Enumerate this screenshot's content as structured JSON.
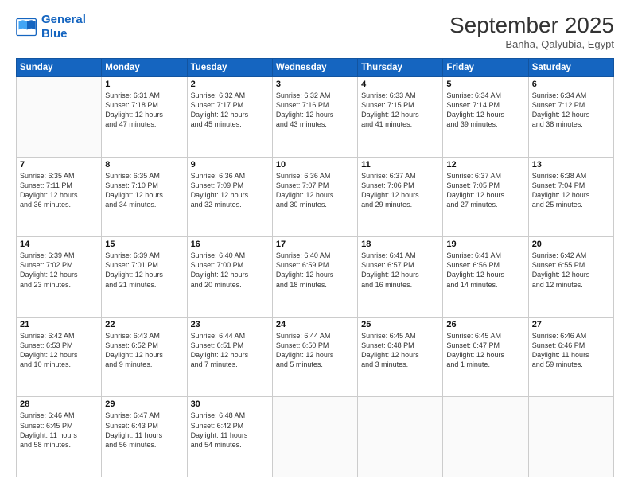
{
  "header": {
    "logo_line1": "General",
    "logo_line2": "Blue",
    "month": "September 2025",
    "location": "Banha, Qalyubia, Egypt"
  },
  "days_of_week": [
    "Sunday",
    "Monday",
    "Tuesday",
    "Wednesday",
    "Thursday",
    "Friday",
    "Saturday"
  ],
  "weeks": [
    [
      {
        "day": "",
        "text": ""
      },
      {
        "day": "1",
        "text": "Sunrise: 6:31 AM\nSunset: 7:18 PM\nDaylight: 12 hours\nand 47 minutes."
      },
      {
        "day": "2",
        "text": "Sunrise: 6:32 AM\nSunset: 7:17 PM\nDaylight: 12 hours\nand 45 minutes."
      },
      {
        "day": "3",
        "text": "Sunrise: 6:32 AM\nSunset: 7:16 PM\nDaylight: 12 hours\nand 43 minutes."
      },
      {
        "day": "4",
        "text": "Sunrise: 6:33 AM\nSunset: 7:15 PM\nDaylight: 12 hours\nand 41 minutes."
      },
      {
        "day": "5",
        "text": "Sunrise: 6:34 AM\nSunset: 7:14 PM\nDaylight: 12 hours\nand 39 minutes."
      },
      {
        "day": "6",
        "text": "Sunrise: 6:34 AM\nSunset: 7:12 PM\nDaylight: 12 hours\nand 38 minutes."
      }
    ],
    [
      {
        "day": "7",
        "text": "Sunrise: 6:35 AM\nSunset: 7:11 PM\nDaylight: 12 hours\nand 36 minutes."
      },
      {
        "day": "8",
        "text": "Sunrise: 6:35 AM\nSunset: 7:10 PM\nDaylight: 12 hours\nand 34 minutes."
      },
      {
        "day": "9",
        "text": "Sunrise: 6:36 AM\nSunset: 7:09 PM\nDaylight: 12 hours\nand 32 minutes."
      },
      {
        "day": "10",
        "text": "Sunrise: 6:36 AM\nSunset: 7:07 PM\nDaylight: 12 hours\nand 30 minutes."
      },
      {
        "day": "11",
        "text": "Sunrise: 6:37 AM\nSunset: 7:06 PM\nDaylight: 12 hours\nand 29 minutes."
      },
      {
        "day": "12",
        "text": "Sunrise: 6:37 AM\nSunset: 7:05 PM\nDaylight: 12 hours\nand 27 minutes."
      },
      {
        "day": "13",
        "text": "Sunrise: 6:38 AM\nSunset: 7:04 PM\nDaylight: 12 hours\nand 25 minutes."
      }
    ],
    [
      {
        "day": "14",
        "text": "Sunrise: 6:39 AM\nSunset: 7:02 PM\nDaylight: 12 hours\nand 23 minutes."
      },
      {
        "day": "15",
        "text": "Sunrise: 6:39 AM\nSunset: 7:01 PM\nDaylight: 12 hours\nand 21 minutes."
      },
      {
        "day": "16",
        "text": "Sunrise: 6:40 AM\nSunset: 7:00 PM\nDaylight: 12 hours\nand 20 minutes."
      },
      {
        "day": "17",
        "text": "Sunrise: 6:40 AM\nSunset: 6:59 PM\nDaylight: 12 hours\nand 18 minutes."
      },
      {
        "day": "18",
        "text": "Sunrise: 6:41 AM\nSunset: 6:57 PM\nDaylight: 12 hours\nand 16 minutes."
      },
      {
        "day": "19",
        "text": "Sunrise: 6:41 AM\nSunset: 6:56 PM\nDaylight: 12 hours\nand 14 minutes."
      },
      {
        "day": "20",
        "text": "Sunrise: 6:42 AM\nSunset: 6:55 PM\nDaylight: 12 hours\nand 12 minutes."
      }
    ],
    [
      {
        "day": "21",
        "text": "Sunrise: 6:42 AM\nSunset: 6:53 PM\nDaylight: 12 hours\nand 10 minutes."
      },
      {
        "day": "22",
        "text": "Sunrise: 6:43 AM\nSunset: 6:52 PM\nDaylight: 12 hours\nand 9 minutes."
      },
      {
        "day": "23",
        "text": "Sunrise: 6:44 AM\nSunset: 6:51 PM\nDaylight: 12 hours\nand 7 minutes."
      },
      {
        "day": "24",
        "text": "Sunrise: 6:44 AM\nSunset: 6:50 PM\nDaylight: 12 hours\nand 5 minutes."
      },
      {
        "day": "25",
        "text": "Sunrise: 6:45 AM\nSunset: 6:48 PM\nDaylight: 12 hours\nand 3 minutes."
      },
      {
        "day": "26",
        "text": "Sunrise: 6:45 AM\nSunset: 6:47 PM\nDaylight: 12 hours\nand 1 minute."
      },
      {
        "day": "27",
        "text": "Sunrise: 6:46 AM\nSunset: 6:46 PM\nDaylight: 11 hours\nand 59 minutes."
      }
    ],
    [
      {
        "day": "28",
        "text": "Sunrise: 6:46 AM\nSunset: 6:45 PM\nDaylight: 11 hours\nand 58 minutes."
      },
      {
        "day": "29",
        "text": "Sunrise: 6:47 AM\nSunset: 6:43 PM\nDaylight: 11 hours\nand 56 minutes."
      },
      {
        "day": "30",
        "text": "Sunrise: 6:48 AM\nSunset: 6:42 PM\nDaylight: 11 hours\nand 54 minutes."
      },
      {
        "day": "",
        "text": ""
      },
      {
        "day": "",
        "text": ""
      },
      {
        "day": "",
        "text": ""
      },
      {
        "day": "",
        "text": ""
      }
    ]
  ]
}
